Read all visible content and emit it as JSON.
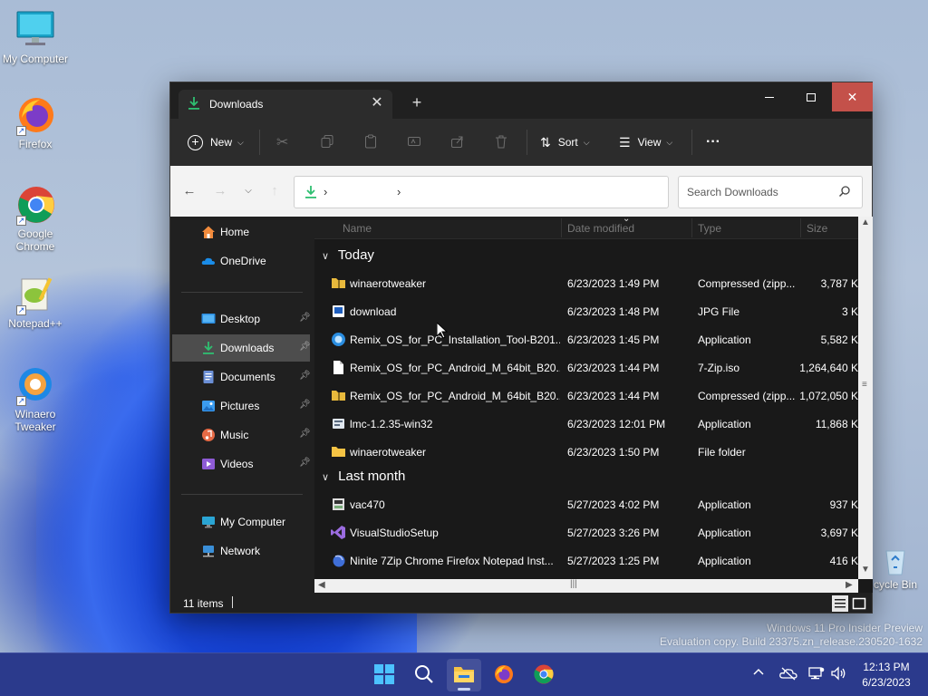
{
  "desktop": {
    "icons": [
      {
        "label": "My Computer"
      },
      {
        "label": "Firefox"
      },
      {
        "label": "Google Chrome"
      },
      {
        "label": "Notepad++"
      },
      {
        "label": "Winaero Tweaker"
      }
    ],
    "recycle_bin_label": "cycle Bin",
    "watermark_line1": "Windows 11 Pro Insider Preview",
    "watermark_line2": "Evaluation copy. Build 23375.zn_release.230520-1632"
  },
  "window": {
    "tab_title": "Downloads",
    "new_tab_symbol": "+",
    "toolbar": {
      "new_label": "New",
      "sort_label": "Sort",
      "view_label": "View",
      "more_label": "···"
    },
    "address": {
      "separator": "›",
      "search_placeholder": "Search Downloads"
    },
    "sidebar": {
      "items": [
        {
          "label": "Home",
          "icon": "home-icon"
        },
        {
          "label": "OneDrive",
          "icon": "cloud-icon"
        },
        {
          "label": "Desktop",
          "icon": "desktop-icon"
        },
        {
          "label": "Downloads",
          "icon": "download-icon"
        },
        {
          "label": "Documents",
          "icon": "documents-icon"
        },
        {
          "label": "Pictures",
          "icon": "pictures-icon"
        },
        {
          "label": "Music",
          "icon": "music-icon"
        },
        {
          "label": "Videos",
          "icon": "videos-icon"
        },
        {
          "label": "My Computer",
          "icon": "computer-icon"
        },
        {
          "label": "Network",
          "icon": "network-icon"
        }
      ]
    },
    "columns": {
      "name": "Name",
      "date": "Date modified",
      "type": "Type",
      "size": "Size"
    },
    "groups": [
      {
        "label": "Today",
        "files": [
          {
            "name": "winaerotweaker",
            "date": "6/23/2023 1:49 PM",
            "type": "Compressed (zipp...",
            "size": "3,787 K",
            "icon": "zip-folder-icon"
          },
          {
            "name": "download",
            "date": "6/23/2023 1:48 PM",
            "type": "JPG File",
            "size": "3 K",
            "icon": "image-file-icon"
          },
          {
            "name": "Remix_OS_for_PC_Installation_Tool-B201...",
            "date": "6/23/2023 1:45 PM",
            "type": "Application",
            "size": "5,582 K",
            "icon": "application-icon"
          },
          {
            "name": "Remix_OS_for_PC_Android_M_64bit_B20...",
            "date": "6/23/2023 1:44 PM",
            "type": "7-Zip.iso",
            "size": "1,264,640 K",
            "icon": "file-icon"
          },
          {
            "name": "Remix_OS_for_PC_Android_M_64bit_B20...",
            "date": "6/23/2023 1:44 PM",
            "type": "Compressed (zipp...",
            "size": "1,072,050 K",
            "icon": "zip-folder-icon"
          },
          {
            "name": "lmc-1.2.35-win32",
            "date": "6/23/2023 12:01 PM",
            "type": "Application",
            "size": "11,868 K",
            "icon": "installer-icon"
          },
          {
            "name": "winaerotweaker",
            "date": "6/23/2023 1:50 PM",
            "type": "File folder",
            "size": "",
            "icon": "folder-icon"
          }
        ]
      },
      {
        "label": "Last month",
        "files": [
          {
            "name": "vac470",
            "date": "5/27/2023 4:02 PM",
            "type": "Application",
            "size": "937 K",
            "icon": "vac-app-icon"
          },
          {
            "name": "VisualStudioSetup",
            "date": "5/27/2023 3:26 PM",
            "type": "Application",
            "size": "3,697 K",
            "icon": "visual-studio-icon"
          },
          {
            "name": "Ninite 7Zip Chrome Firefox Notepad Inst...",
            "date": "5/27/2023 1:25 PM",
            "type": "Application",
            "size": "416 K",
            "icon": "ninite-icon"
          }
        ]
      }
    ],
    "status": {
      "item_count": "11 items"
    }
  },
  "taskbar": {
    "time": "12:13 PM",
    "date": "6/23/2023"
  },
  "colors": {
    "window_bg": "#202020",
    "toolbar_bg": "#2c2c2c",
    "close_red": "#c4514a",
    "selected_nav": "#4d4d4d",
    "taskbar": "#2b3a8c",
    "download_green": "#2fbf71"
  }
}
